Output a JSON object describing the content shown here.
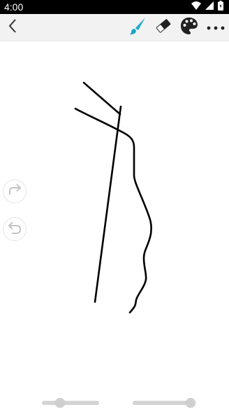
{
  "status_bar": {
    "time": "4:00",
    "icons": [
      "wifi-icon",
      "signal-icon",
      "battery-icon"
    ]
  },
  "toolbar": {
    "back_icon": "chevron-left-icon",
    "tools": [
      {
        "name": "brush-icon",
        "color": "#1aa7c7",
        "active": true
      },
      {
        "name": "eraser-icon",
        "color": "#222222",
        "active": false
      },
      {
        "name": "palette-icon",
        "color": "#222222",
        "active": false
      },
      {
        "name": "more-icon",
        "color": "#222222",
        "active": false
      }
    ]
  },
  "side_controls": [
    "redo-icon",
    "undo-icon"
  ],
  "canvas": {
    "stroke_color": "#000000"
  },
  "sliders": {
    "brush_size": {
      "value": 0.28
    },
    "opacity": {
      "value": 1.0
    }
  }
}
